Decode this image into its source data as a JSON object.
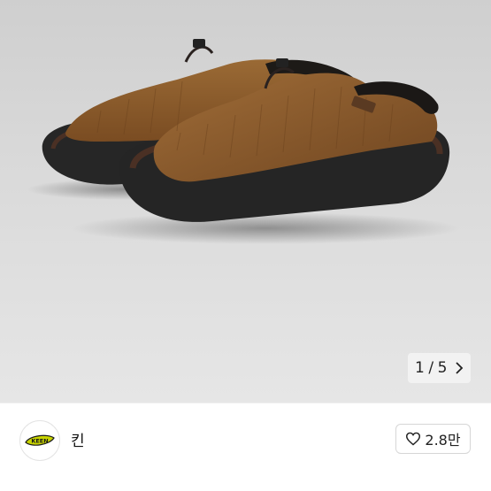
{
  "gallery": {
    "product_alt": "KEEN brown fur slip-on shoes",
    "pager": {
      "current": "1",
      "separator": "/",
      "total": "5"
    }
  },
  "brand": {
    "logo_text": "KEEN",
    "name": "킨",
    "follow_count": "2.8만"
  },
  "colors": {
    "fur": "#8a5a2b",
    "sole": "#2a2a2a",
    "leather": "#4a3024",
    "logo_yellow": "#c8d400"
  },
  "icons": {
    "pager_next": "chevron-right-icon",
    "follow": "heart-outline-icon"
  }
}
